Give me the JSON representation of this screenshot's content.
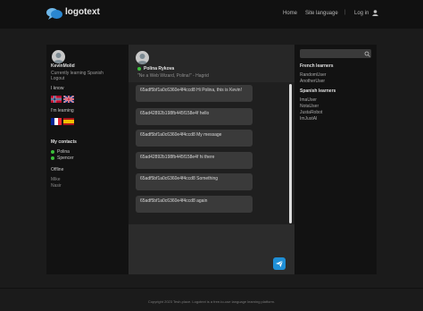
{
  "header": {
    "logo_text": "logotext",
    "nav": {
      "home": "Home",
      "site_language": "Site language",
      "login": "Log in"
    }
  },
  "profile": {
    "username": "KevinMolid",
    "status_lines": [
      "Currently learning Spanish",
      "Logout"
    ],
    "i_know_label": "I know",
    "learning_label": "I'm learning",
    "known_languages": [
      "Norwegian",
      "English"
    ],
    "learning_languages": [
      "French",
      "Spanish"
    ]
  },
  "contacts": {
    "title": "My contacts",
    "online": [
      "Polina",
      "Spencer"
    ],
    "offline_label": "Offline",
    "offline": [
      "Mike",
      "Nasir"
    ]
  },
  "chat": {
    "name": "Polina Rykova",
    "quote": "\"Ne a Web Wizard, Polina!\" - Hagrid",
    "messages": [
      "65adf5bf1a0c6360e4f4ccd8 Hi Polina, this is Kevin!",
      "65ad42892b198fb445f158e4f hello",
      "65adf5bf1a0c6360e4f4ccd8 My message",
      "65ad42892b198fb445f158e4f hi there",
      "65adf5bf1a0c6360e4f4ccd8 Something",
      "65adf5bf1a0c6360e4f4ccd8 again"
    ]
  },
  "right": {
    "search_placeholder": "",
    "french_heading": "French learners",
    "french_users": [
      "RandomUser",
      "AnotherUser"
    ],
    "spanish_heading": "Spanish learners",
    "spanish_users": [
      "ImaUser",
      "NotaUser",
      "JustaRobot",
      "ImJustAI"
    ]
  },
  "footer": {
    "text": "Copyright 2023 Tesh.place. Logotext is a free-to-use language learning platform."
  },
  "colors": {
    "accent": "#1f8fd6",
    "online": "#3bbf3b",
    "bg": "#1b1b1b"
  },
  "icons": [
    "chat-bubble-logo-icon",
    "user-icon",
    "avatar-icon",
    "flag-norway",
    "flag-uk",
    "flag-france",
    "flag-spain",
    "search-icon",
    "send-icon"
  ]
}
